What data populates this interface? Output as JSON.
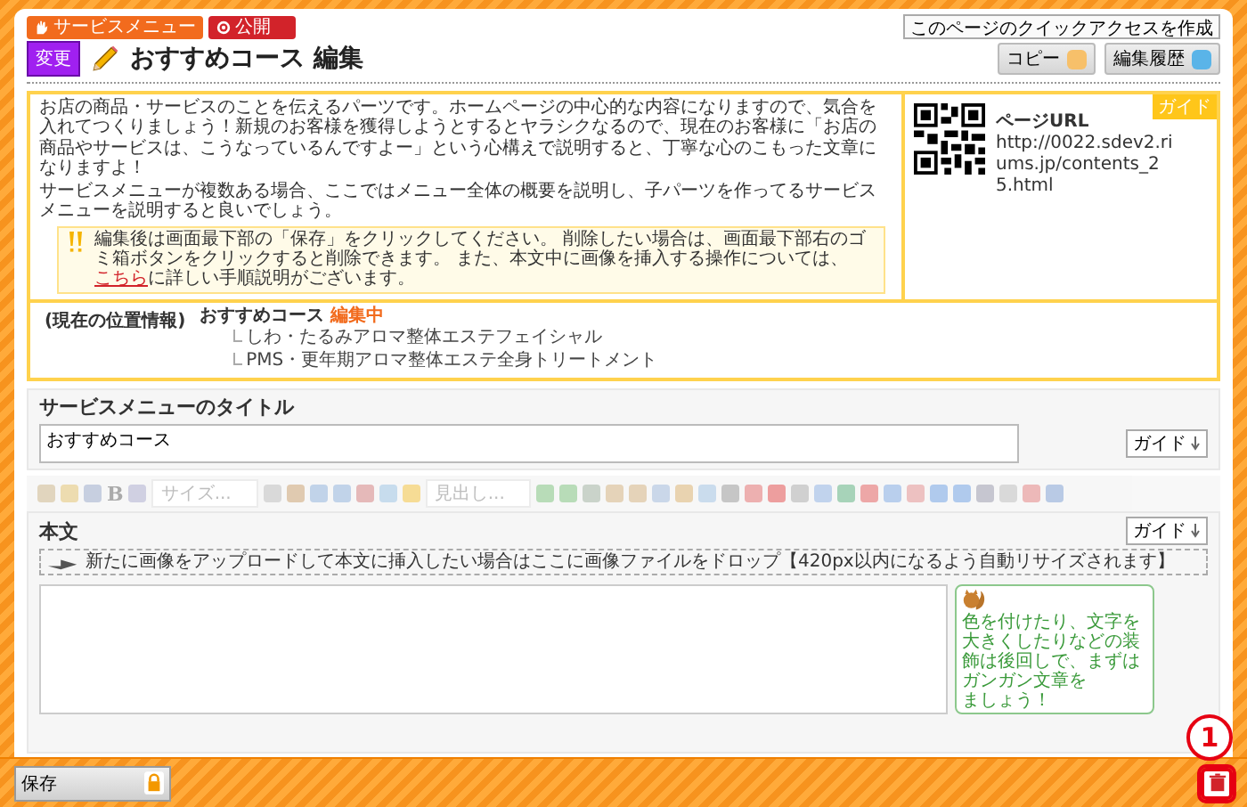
{
  "header": {
    "category_badge": "サービスメニュー",
    "status_badge": "公開",
    "quick_access": "このページのクイックアクセスを作成"
  },
  "title_bar": {
    "mode_badge": "変更",
    "title": "おすすめコース 編集",
    "buttons": [
      {
        "label": "コピー",
        "kind": "copy"
      },
      {
        "label": "編集履歴",
        "kind": "history"
      }
    ]
  },
  "guide": {
    "tag": "ガイド",
    "paragraphs": [
      "お店の商品・サービスのことを伝えるパーツです。ホームページの中心的な内容になりますので、気合を入れてつくりましょう！新規のお客様を獲得しようとするとヤラシクなるので、現在のお客様に「お店の商品やサービスは、こうなっているんですよー」という心構えで説明すると、丁寧な心のこもった文章になりますよ！",
      "サービスメニューが複数ある場合、ここではメニュー全体の概要を説明し、子パーツを作ってるサービスメニューを説明すると良いでしょう。"
    ],
    "notice": {
      "before": "編集後は画面最下部の「保存」をクリックしてください。 削除したい場合は、画面最下部右のゴミ箱ボタンをクリックすると削除できます。 また、本文中に画像を挿入する操作については、",
      "link": "こちら",
      "after": "に詳しい手順説明がございます。"
    },
    "page_url": {
      "label": "ページURL",
      "url": "http://0022.sdev2.riums.jp/contents_25.html"
    },
    "location": {
      "label": "(現在の位置情報)",
      "current": "おすすめコース",
      "status": "編集中",
      "children": [
        {
          "label": "しわ・たるみアロマ整体エステフェイシャル"
        },
        {
          "label": "PMS・更年期アロマ整体エステ全身トリートメント"
        }
      ]
    }
  },
  "title_field": {
    "heading": "サービスメニューのタイトル",
    "value": "おすすめコース",
    "guide_button": "ガイド"
  },
  "toolbar": {
    "bold": "B",
    "size_select": "サイズ...",
    "heading_select": "見出し..."
  },
  "body": {
    "heading": "本文",
    "drop_hint": "新たに画像をアップロードして本文に挿入したい場合はここに画像ファイルをドロップ【420px以内になるよう自動リサイズされます】",
    "guide_button": "ガイド",
    "tip_lines": [
      "色を付けたり、文字を大きくしたりなどの装飾は後回しで、まずはガンガン文章を",
      "ましょう！"
    ]
  },
  "footer": {
    "save_button": "保存",
    "marker": "1"
  }
}
